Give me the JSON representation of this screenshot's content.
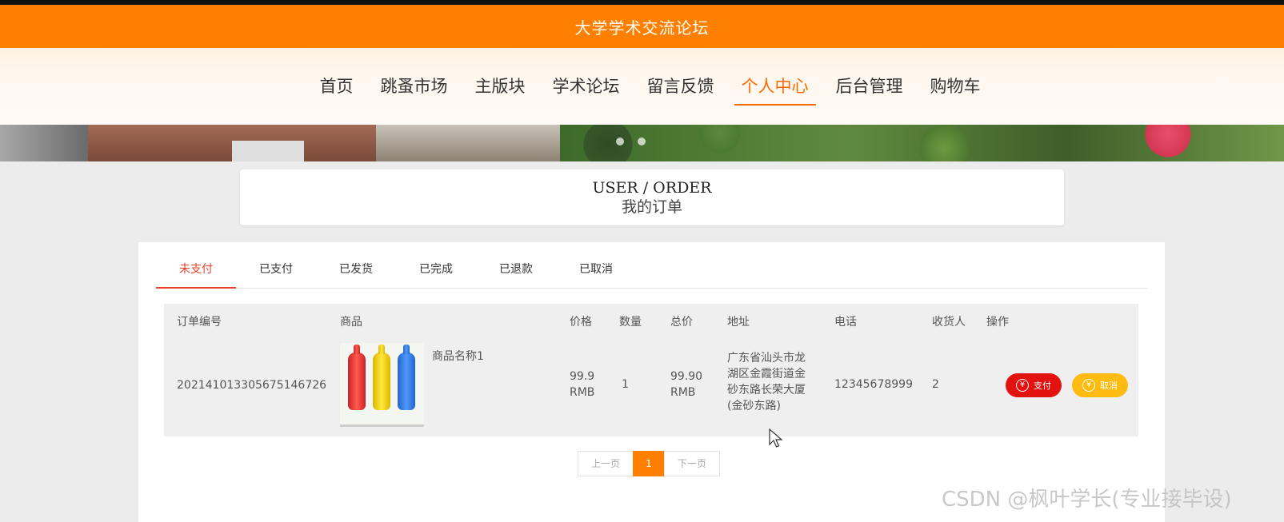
{
  "header": {
    "site_title": "大学学术交流论坛"
  },
  "nav": {
    "items": [
      "首页",
      "跳蚤市场",
      "主版块",
      "学术论坛",
      "留言反馈",
      "个人中心",
      "后台管理",
      "购物车"
    ],
    "active_index": 5
  },
  "heading": {
    "en": "USER / ORDER",
    "cn": "我的订单"
  },
  "tabs": {
    "items": [
      "未支付",
      "已支付",
      "已发货",
      "已完成",
      "已退款",
      "已取消"
    ],
    "active_index": 0
  },
  "table": {
    "headers": {
      "order_no": "订单编号",
      "product": "商品",
      "price": "价格",
      "quantity": "数量",
      "total": "总价",
      "address": "地址",
      "phone": "电话",
      "receiver": "收货人",
      "actions": "操作"
    },
    "rows": [
      {
        "order_no": "2021410133056751467​26",
        "product_name": "商品名称1",
        "price_value": "99.9",
        "price_unit": "RMB",
        "quantity": "1",
        "total_value": "99.90",
        "total_unit": "RMB",
        "address_lines": [
          "广东省汕头市龙",
          "湖区金霞街道金",
          "砂东路长荣大厦",
          "(金砂东路)"
        ],
        "phone": "12345678999",
        "receiver": "2",
        "pay_label": "支付",
        "cancel_label": "取消"
      }
    ]
  },
  "pagination": {
    "prev": "上一页",
    "current": "1",
    "next": "下一页"
  },
  "watermark": "CSDN @枫叶学长(专业接毕设)",
  "colors": {
    "brand": "#ff7f00",
    "active_tab": "#e8412c",
    "pay": "#e2120f",
    "cancel": "#ffbb10"
  },
  "icons": {
    "coin": "yen-coin-icon"
  }
}
